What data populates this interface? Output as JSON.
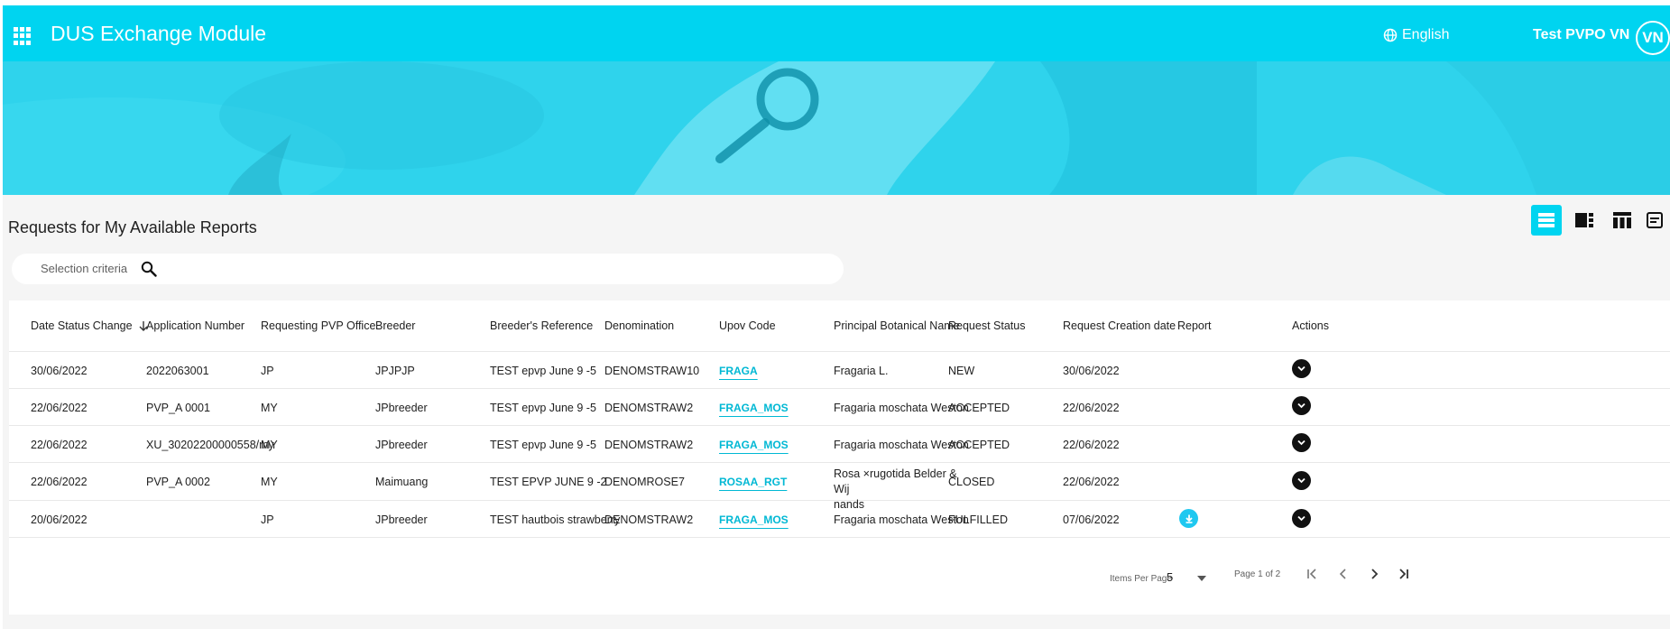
{
  "header": {
    "app_title": "DUS Exchange Module",
    "language": "English",
    "user_name": "Test PVPO VN",
    "user_initials": "VN"
  },
  "page": {
    "section_title": "Requests for My Available Reports"
  },
  "search": {
    "placeholder": "Selection criteria"
  },
  "view_modes": [
    {
      "icon": "list-view-icon",
      "active": true
    },
    {
      "icon": "split-view-icon",
      "active": false
    },
    {
      "icon": "table-columns-icon",
      "active": false
    },
    {
      "icon": "card-view-icon",
      "active": false
    }
  ],
  "table": {
    "columns": [
      "Date Status Change",
      "Application Number",
      "Requesting PVP Office",
      "Breeder",
      "Breeder's Reference",
      "Denomination",
      "Upov Code",
      "Principal Botanical Name",
      "Request Status",
      "Request Creation date",
      "Report",
      "Actions"
    ],
    "sort_column": "Date Status Change",
    "sort_direction": "descending",
    "rows": [
      {
        "date_status_change": "30/06/2022",
        "application_number": "2022063001",
        "requesting_office": "JP",
        "breeder": "JPJPJP",
        "breeder_reference": "TEST epvp June 9 -5",
        "denomination": "DENOMSTRAW10",
        "upov_code": "FRAGA",
        "botanical_name": "Fragaria L.",
        "request_status": "NEW",
        "request_creation_date": "30/06/2022",
        "has_report": false
      },
      {
        "date_status_change": "22/06/2022",
        "application_number": "PVP_A 0001",
        "requesting_office": "MY",
        "breeder": "JPbreeder",
        "breeder_reference": "TEST epvp June 9 -5",
        "denomination": "DENOMSTRAW2",
        "upov_code": "FRAGA_MOS",
        "botanical_name": "Fragaria moschata Weston",
        "request_status": "ACCEPTED",
        "request_creation_date": "22/06/2022",
        "has_report": false
      },
      {
        "date_status_change": "22/06/2022",
        "application_number": "XU_30202200000558/my",
        "requesting_office": "MY",
        "breeder": "JPbreeder",
        "breeder_reference": "TEST epvp June 9 -5",
        "denomination": "DENOMSTRAW2",
        "upov_code": "FRAGA_MOS",
        "botanical_name": "Fragaria moschata Weston",
        "request_status": "ACCEPTED",
        "request_creation_date": "22/06/2022",
        "has_report": false
      },
      {
        "date_status_change": "22/06/2022",
        "application_number": "PVP_A 0002",
        "requesting_office": "MY",
        "breeder": "Maimuang",
        "breeder_reference": "TEST EPVP JUNE 9 -2",
        "denomination": "DENOMROSE7",
        "upov_code": "ROSAA_RGT",
        "botanical_name_line1": "Rosa ×rugotida Belder & Wij",
        "botanical_name_line2": "nands",
        "request_status": "CLOSED",
        "request_creation_date": "22/06/2022",
        "has_report": false
      },
      {
        "date_status_change": "20/06/2022",
        "application_number": "",
        "requesting_office": "JP",
        "breeder": "JPbreeder",
        "breeder_reference": "TEST hautbois strawberry",
        "denomination": "DENOMSTRAW2",
        "upov_code": "FRAGA_MOS",
        "botanical_name": "Fragaria moschata Weston",
        "request_status": "FULFILLED",
        "request_creation_date": "07/06/2022",
        "has_report": true
      }
    ]
  },
  "pagination": {
    "items_per_page_label": "Items Per Page",
    "items_per_page": "5",
    "page_info": "Page 1 of 2"
  },
  "colors": {
    "accent": "#00d4f0",
    "link": "#00b8d4",
    "action_button": "#111111",
    "report_button": "#1fc8f0",
    "background": "#f5f5f5"
  }
}
